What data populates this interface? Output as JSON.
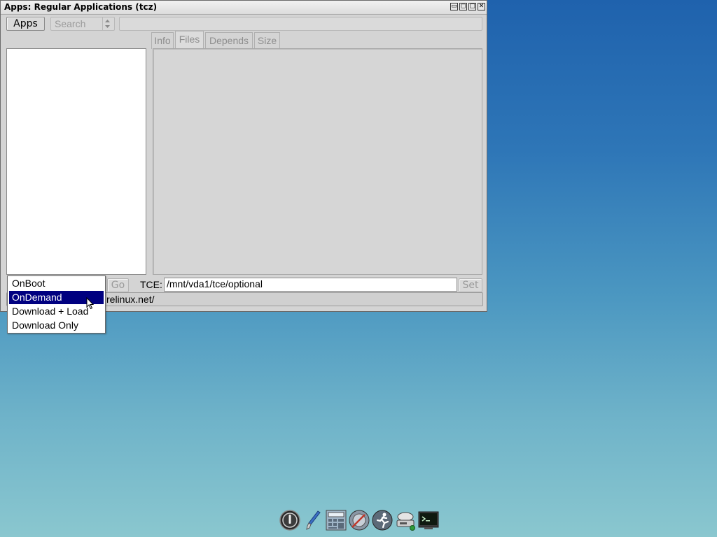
{
  "window": {
    "title": "Apps: Regular Applications (tcz)",
    "controls": [
      "▭",
      "◻",
      "▢",
      "✕"
    ]
  },
  "toolbar": {
    "apps_label": "Apps",
    "search_label": "Search",
    "search_field_value": ""
  },
  "tabs": [
    {
      "label": "Info"
    },
    {
      "label": "Files"
    },
    {
      "label": "Depends"
    },
    {
      "label": "Size"
    }
  ],
  "bottom": {
    "go_label": "Go",
    "tce_label": "TCE:",
    "tce_path": "/mnt/vda1/tce/optional",
    "set_label": "Set",
    "mirror_text": "relinux.net/"
  },
  "dropdown": {
    "items": [
      "OnBoot",
      "OnDemand",
      "Download + Load",
      "Download Only"
    ],
    "selected": "OnDemand"
  },
  "dock": {
    "icons": [
      "power-icon",
      "paintbrush-icon",
      "calculator-icon",
      "mount-tool-icon",
      "apps-runner-icon",
      "network-icon",
      "terminal-icon"
    ]
  },
  "colors": {
    "selection": "#000080",
    "desktop_top": "#1f62ad",
    "desktop_bottom": "#8ac7cf"
  }
}
